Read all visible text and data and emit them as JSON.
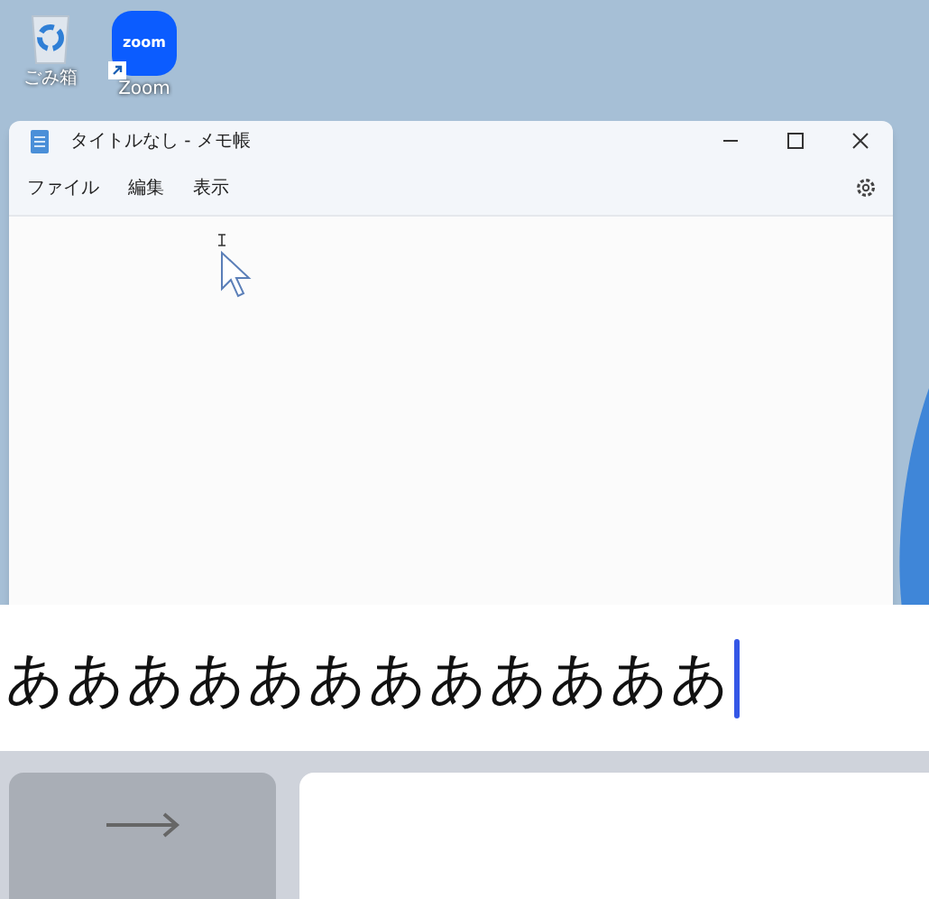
{
  "desktop": {
    "icons": [
      {
        "kind": "recycle",
        "label": "ごみ箱"
      },
      {
        "kind": "zoom",
        "label": "Zoom",
        "badge": "zoom"
      }
    ]
  },
  "window": {
    "title": "タイトルなし - メモ帳",
    "menu": [
      "ファイル",
      "編集",
      "表示"
    ]
  },
  "ime": {
    "text": "ああああああああああああ"
  },
  "keyboard": {
    "keys": [
      {
        "kind": "arrow"
      },
      {
        "kind": "blank"
      }
    ]
  }
}
